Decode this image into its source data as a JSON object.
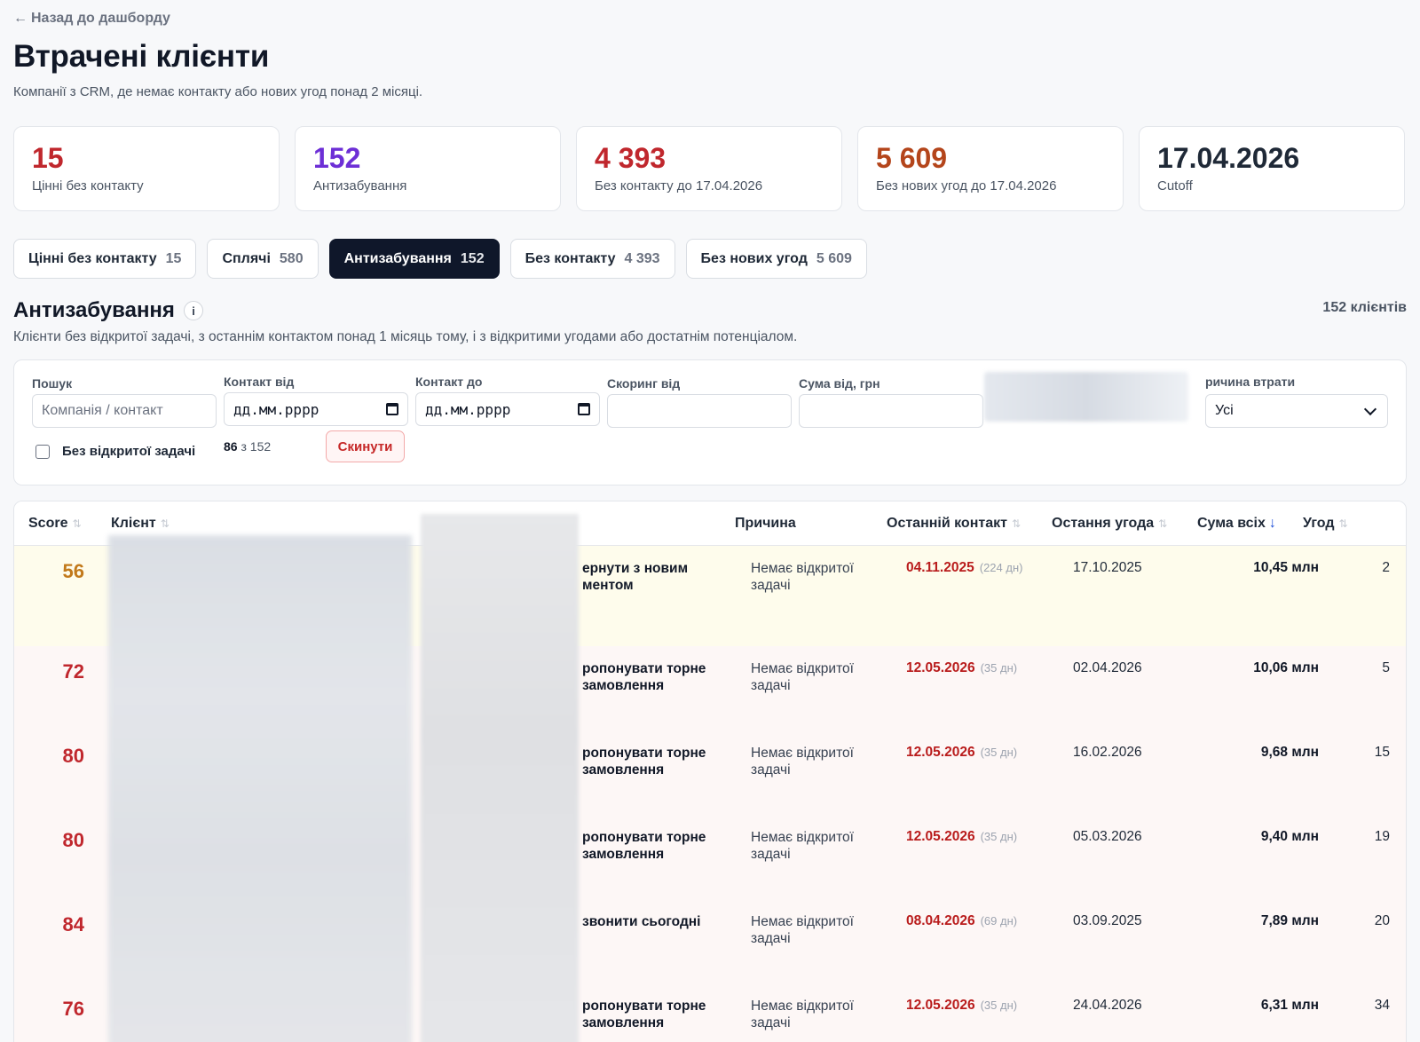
{
  "nav": {
    "back_arrow": "←",
    "back_label": "Назад до дашборду"
  },
  "page": {
    "title": "Втрачені клієнти",
    "subtitle": "Компанії з CRM, де немає контакту або нових угод понад 2 місяці."
  },
  "stats": [
    {
      "value": "15",
      "label": "Цінні без контакту",
      "color": "#c0272d"
    },
    {
      "value": "152",
      "label": "Антизабування",
      "color": "#6d2fd6"
    },
    {
      "value": "4 393",
      "label": "Без контакту до 17.04.2026",
      "color": "#c0272d"
    },
    {
      "value": "5 609",
      "label": "Без нових угод до 17.04.2026",
      "color": "#b4451b"
    },
    {
      "value": "17.04.2026",
      "label": "Cutoff",
      "color": "#1f2937"
    }
  ],
  "tabs": [
    {
      "label": "Цінні без контакту",
      "count": "15",
      "active": false
    },
    {
      "label": "Сплячі",
      "count": "580",
      "active": false
    },
    {
      "label": "Антизабування",
      "count": "152",
      "active": true
    },
    {
      "label": "Без контакту",
      "count": "4 393",
      "active": false
    },
    {
      "label": "Без нових угод",
      "count": "5 609",
      "active": false
    }
  ],
  "section": {
    "title": "Антизабування",
    "info": "i",
    "count": "152 клієнтів",
    "description": "Клієнти без відкритої задачі, з останнім контактом понад 1 місяць тому, і з відкритими угодами або достатнім потенціалом."
  },
  "filters": {
    "search_label": "Пошук",
    "search_placeholder": "Компанія / контакт",
    "contact_from_label": "Контакт від",
    "contact_from_value": "дд.мм.рррр",
    "contact_to_label": "Контакт до",
    "contact_to_value": "дд.мм.рррр",
    "score_from_label": "Скоринг від",
    "sum_from_label": "Сума від, грн",
    "reason_label": "ричина втрати",
    "reason_value": "Усі",
    "no_task_label": "Без відкритої задачі",
    "shown": "86",
    "shown_of": "з 152",
    "reset_label": "Скинути"
  },
  "table": {
    "headers": {
      "score": "Score",
      "client": "Клієнт",
      "reason": "Причина",
      "last_contact": "Останній контакт",
      "last_deal": "Остання угода",
      "sum": "Сума всіх",
      "deals": "Угод"
    },
    "sort_idle": "⇅",
    "sort_active": "↓",
    "rows": [
      {
        "score": "56",
        "score_color": "#c2791a",
        "bg": "#fefcec",
        "action": "ернути з новим ментом",
        "reason": "Немає відкритої задачі",
        "last_contact": "04.11.2025",
        "days": "(224 дн)",
        "last_deal": "17.10.2025",
        "sum": "10,45 млн",
        "deals": "2"
      },
      {
        "score": "72",
        "score_color": "#c0272d",
        "bg": "#fdf7f6",
        "action": "ропонувати торне замовлення",
        "reason": "Немає відкритої задачі",
        "last_contact": "12.05.2026",
        "days": "(35 дн)",
        "last_deal": "02.04.2026",
        "sum": "10,06 млн",
        "deals": "5"
      },
      {
        "score": "80",
        "score_color": "#c0272d",
        "bg": "#fdf7f6",
        "action": "ропонувати торне замовлення",
        "reason": "Немає відкритої задачі",
        "last_contact": "12.05.2026",
        "days": "(35 дн)",
        "last_deal": "16.02.2026",
        "sum": "9,68 млн",
        "deals": "15"
      },
      {
        "score": "80",
        "score_color": "#c0272d",
        "bg": "#fdf7f6",
        "action": "ропонувати торне замовлення",
        "reason": "Немає відкритої задачі",
        "last_contact": "12.05.2026",
        "days": "(35 дн)",
        "last_deal": "05.03.2026",
        "sum": "9,40 млн",
        "deals": "19"
      },
      {
        "score": "84",
        "score_color": "#c0272d",
        "bg": "#fdf7f6",
        "action": "звонити сьогодні",
        "reason": "Немає відкритої задачі",
        "last_contact": "08.04.2026",
        "days": "(69 дн)",
        "last_deal": "03.09.2025",
        "sum": "7,89 млн",
        "deals": "20"
      },
      {
        "score": "76",
        "score_color": "#c0272d",
        "bg": "#fdf7f6",
        "action": "ропонувати торне замовлення",
        "reason": "Немає відкритої задачі",
        "last_contact": "12.05.2026",
        "days": "(35 дн)",
        "last_deal": "24.04.2026",
        "sum": "6,31 млн",
        "deals": "34"
      }
    ]
  }
}
